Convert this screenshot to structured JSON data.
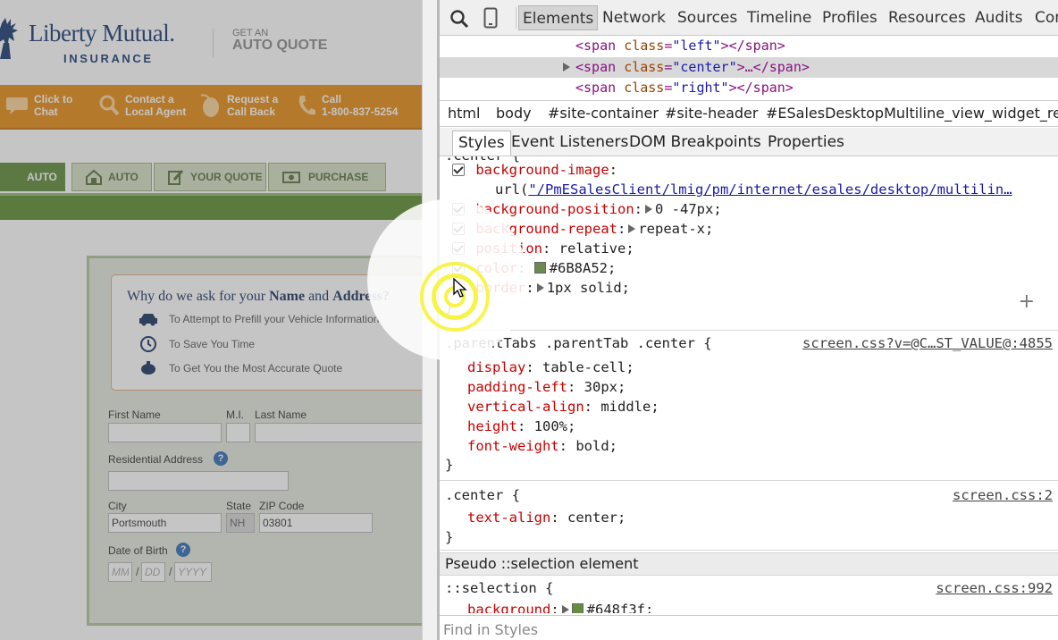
{
  "site": {
    "brand": "Liberty Mutual.",
    "brand_sub": "INSURANCE",
    "get_an": "GET AN",
    "auto_quote": "AUTO QUOTE",
    "contacts": [
      {
        "line1": "Click to",
        "line2": "Chat",
        "icon": "chat-bubble-icon"
      },
      {
        "line1": "Contact a",
        "line2": "Local Agent",
        "icon": "magnifier-icon"
      },
      {
        "line1": "Request a",
        "line2": "Call Back",
        "icon": "mouse-icon"
      },
      {
        "line1": "Call",
        "line2": "1-800-837-5254",
        "icon": "phone-icon"
      }
    ],
    "steps": [
      "AUTO",
      "AUTO",
      "YOUR QUOTE",
      "PURCHASE"
    ],
    "why": {
      "title_pre": "Why do we ask for your ",
      "title_name": "Name",
      "title_and": " and ",
      "title_address": "Address?",
      "items": [
        {
          "text": "To Attempt to Prefill your Vehicle Information",
          "icon": "car-icon"
        },
        {
          "text": "To Save You Time",
          "icon": "clock-icon"
        },
        {
          "text": "To Get You the Most Accurate Quote",
          "icon": "piggy-bank-icon"
        }
      ]
    },
    "form": {
      "first_name_label": "First Name",
      "mi_label": "M.I.",
      "last_name_label": "Last Name",
      "address_label": "Residential Address",
      "city_label": "City",
      "city_value": "Portsmouth",
      "state_label": "State",
      "state_value": "NH",
      "zip_label": "ZIP Code",
      "zip_value": "03801",
      "dob_label": "Date of Birth",
      "dob_mm": "MM",
      "dob_dd": "DD",
      "dob_yyyy": "YYYY",
      "slash": "/",
      "help": "?"
    }
  },
  "devtools": {
    "tabs": [
      "Elements",
      "Network",
      "Sources",
      "Timeline",
      "Profiles",
      "Resources",
      "Audits",
      "Con"
    ],
    "dom": [
      {
        "open": "<span ",
        "attr": "class",
        "eq": "=",
        "val": "\"left\"",
        "close": "></span>"
      },
      {
        "open": "<span ",
        "attr": "class",
        "eq": "=",
        "val": "\"center\"",
        "close": ">…</span>"
      },
      {
        "open": "<span ",
        "attr": "class",
        "eq": "=",
        "val": "\"right\"",
        "close": "></span>"
      }
    ],
    "breadcrumbs": [
      "html",
      "body",
      "#site-container",
      "#site-header",
      "#ESalesDesktopMultiline_view_widget_region"
    ],
    "side_tabs": [
      "Styles",
      "Event Listeners",
      "DOM Breakpoints",
      "Properties"
    ],
    "rule1": {
      "selector": ".center {",
      "decls": [
        {
          "prop": "background-image",
          "sep": ":",
          "checked": true
        },
        {
          "url_pre": "url(",
          "url": "\"/PmESalesClient/lmig/pm/internet/esales/desktop/multilin…"
        },
        {
          "prop": "background-position",
          "sep": ":",
          "value": "0 -47px;",
          "checked": true
        },
        {
          "prop": "background-repeat",
          "sep": ":",
          "value": "repeat-x;",
          "checked": true
        },
        {
          "prop": "position",
          "sep": ": ",
          "value": "relative;",
          "checked": true
        },
        {
          "prop": "color",
          "sep": ": ",
          "value": "#6B8A52;",
          "swatch": "#6B8A52",
          "checked": true
        },
        {
          "prop": "border",
          "sep": ":",
          "value": "1px solid;",
          "checked": false
        }
      ],
      "close": "}",
      "plus": "+"
    },
    "rule2": {
      "selector": ".parentTabs .parentTab .center {",
      "source": "screen.css?v=@C…ST_VALUE@:4855",
      "decls": [
        {
          "prop": "display",
          "value": "table-cell;"
        },
        {
          "prop": "padding-left",
          "value": "30px;"
        },
        {
          "prop": "vertical-align",
          "value": "middle;"
        },
        {
          "prop": "height",
          "value": "100%;"
        },
        {
          "prop": "font-weight",
          "value": "bold;"
        }
      ],
      "close": "}"
    },
    "rule3": {
      "selector": ".center {",
      "source": "screen.css:2",
      "decls": [
        {
          "prop": "text-align",
          "value": "center;"
        }
      ],
      "close": "}"
    },
    "pseudo_header": "Pseudo ::selection element",
    "rule4": {
      "selector": "::selection {",
      "source": "screen.css:992",
      "decl_prop": "background",
      "decl_value": "#648f3f;",
      "swatch": "#648f3f"
    },
    "find_placeholder": "Find in Styles"
  },
  "colors": {
    "orange_bar": "#e58a12",
    "green_band": "#5c8c2e",
    "brand_blue": "#1a3a72",
    "click_ring": "#f7f33c"
  }
}
